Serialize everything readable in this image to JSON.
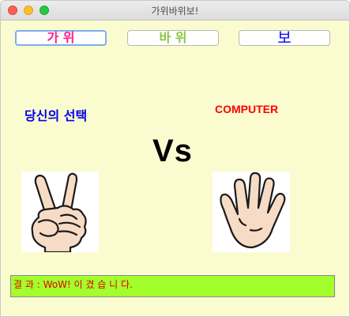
{
  "window": {
    "title": "가위바위보!"
  },
  "buttons": {
    "scissors": "가 위",
    "rock": "바 위",
    "paper": "보"
  },
  "labels": {
    "user": "당신의 선택",
    "computer": "COMPUTER",
    "vs": "Vs"
  },
  "choices": {
    "user_hand": "scissors-hand-icon",
    "computer_hand": "paper-hand-icon"
  },
  "result": {
    "text": "결 과 : WoW! 이 겼 습 니 다."
  },
  "colors": {
    "background": "#fbfbd0",
    "scissors_text": "#ff1e8a",
    "rock_text": "#8cc63f",
    "paper_text": "#0000ff",
    "user_label": "#0000ee",
    "computer_label": "#ff0000",
    "result_bg": "#a2ff2c",
    "result_text": "#e60000"
  }
}
